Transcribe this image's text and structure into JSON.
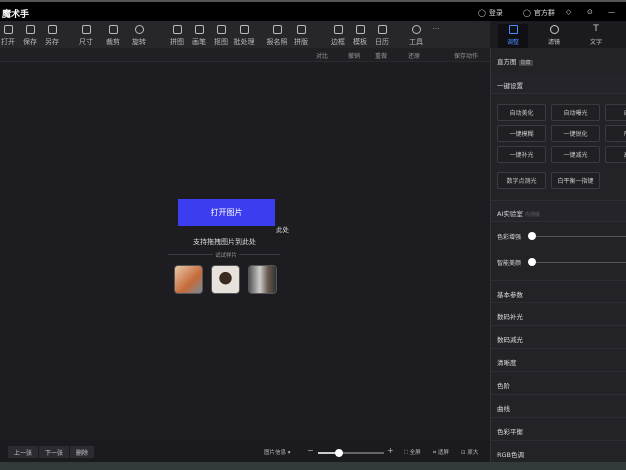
{
  "app": {
    "title": "魔术手",
    "login": "登录",
    "group": "官方群"
  },
  "toolbar": [
    "打开",
    "保存",
    "另存",
    "尺寸",
    "裁剪",
    "旋转",
    "拼图",
    "画笔",
    "抠图",
    "批处理",
    "报名照",
    "拼版",
    "边框",
    "模板",
    "日历",
    "工具",
    "..."
  ],
  "subbar": {
    "compare": "对比",
    "undo": "撤销",
    "redo": "重做",
    "restore": "还原",
    "save_action": "保存动作"
  },
  "canvas": {
    "open": "打开图片",
    "hint": "支持拖拽图片到此处",
    "try": "试试样片",
    "stray": "此处"
  },
  "bottom": {
    "prev": "上一张",
    "next": "下一张",
    "delete": "删除",
    "info": "图片信息 ▾",
    "fullscreen": "全屏",
    "fit": "适屏",
    "original": "原大"
  },
  "right": {
    "tabs": [
      "调整",
      "滤镜",
      "文字"
    ],
    "histogram": "直方图",
    "histogram_tag": "隐藏",
    "one_key": "一键设置",
    "buttons": [
      "自动美化",
      "自动曝光",
      "自动",
      "一键模糊",
      "一键锐化",
      "严重",
      "一键补光",
      "一键减光",
      "高IS",
      "数字点测光",
      "白平衡一指键"
    ],
    "ai_lab": "AI实验室",
    "ai_tag": "内测版",
    "sliders": [
      {
        "label": "色彩增强",
        "value": 0
      },
      {
        "label": "智能美颜",
        "value": 0
      }
    ],
    "items": [
      "基本参数",
      "数码补光",
      "数码减光",
      "清晰度",
      "色阶",
      "曲线",
      "色彩平衡",
      "RGB色调"
    ]
  }
}
